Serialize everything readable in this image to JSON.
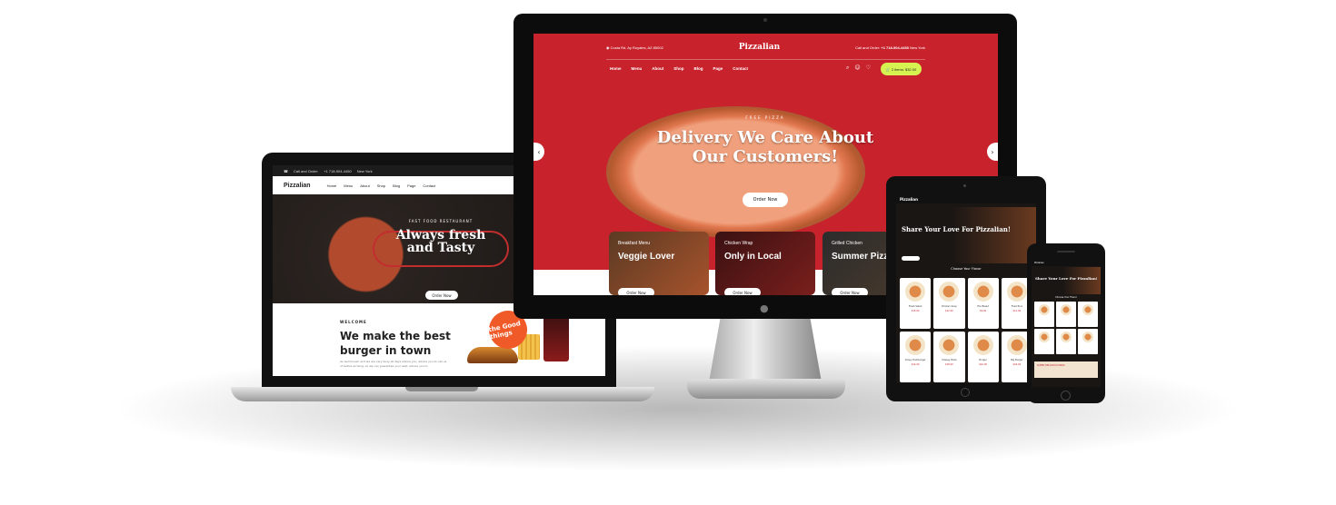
{
  "brand": "Pizzalian",
  "laptop": {
    "topbar_phone_label": "Call and Order:",
    "topbar_phone": "+1 718-904-4450",
    "topbar_city": "New York",
    "nav": [
      "Home",
      "Menu",
      "About",
      "Shop",
      "Blog",
      "Page",
      "Contact"
    ],
    "hero_subtitle": "FAST FOOD RESTAURANT",
    "hero_title": "Always fresh and Tasty",
    "hero_button": "Order Now",
    "welcome_label": "WELCOME",
    "welcome_title": "We make the best burger in town",
    "welcome_text": "As well known and we are very busy all days advice you, advice you to call us of before arriving, so we can guarantee your seat. advice you to",
    "badge": "the Good things"
  },
  "imac": {
    "address": "Costa Rd, Ay Royales, AZ 85002",
    "phone_label": "Call and Order:",
    "phone": "+1 718-904-4450",
    "city": "New York",
    "nav": [
      "Home",
      "Menu",
      "About",
      "Shop",
      "Blog",
      "Page",
      "Contact"
    ],
    "cart": "2 items: $32.00",
    "hero_subtitle": "FREE PIZZA",
    "hero_title": "Delivery We Care About Our Customers!",
    "hero_button": "Order Now",
    "cards": [
      {
        "label": "Breakfast Menu",
        "title": "Veggie Lover",
        "button": "Order Now"
      },
      {
        "label": "Chicken Wrap",
        "title": "Only in Local",
        "button": "Order Now"
      },
      {
        "label": "Grilled Chicken",
        "title": "Summer Pizza",
        "button": "Order Now"
      }
    ]
  },
  "tablet": {
    "hero_title": "Share Your Love For Pizzalian!",
    "section_title": "Choose Your Flavor",
    "items": [
      {
        "name": "Fresh Salad",
        "price": "$15.00"
      },
      {
        "name": "Chicken Soup",
        "price": "$12.00"
      },
      {
        "name": "Fire Bread",
        "price": "$9.00"
      },
      {
        "name": "Fried Rice",
        "price": "$11.00"
      },
      {
        "name": "Crispy Hamburger",
        "price": "$14.00"
      },
      {
        "name": "Cheesy Pizza",
        "price": "$18.00"
      },
      {
        "name": "Burger",
        "price": "$10.00"
      },
      {
        "name": "Big Burger",
        "price": "$16.00"
      }
    ]
  },
  "phone": {
    "hero_title": "Share Your Love For Pizzalian!",
    "section_title": "Choose Your Flavor",
    "promo": "SUPER DELICIOUS PIZZA"
  },
  "colors": {
    "primary_red": "#c8232c",
    "accent_lime": "#d6f251",
    "dark": "#1a1614"
  }
}
